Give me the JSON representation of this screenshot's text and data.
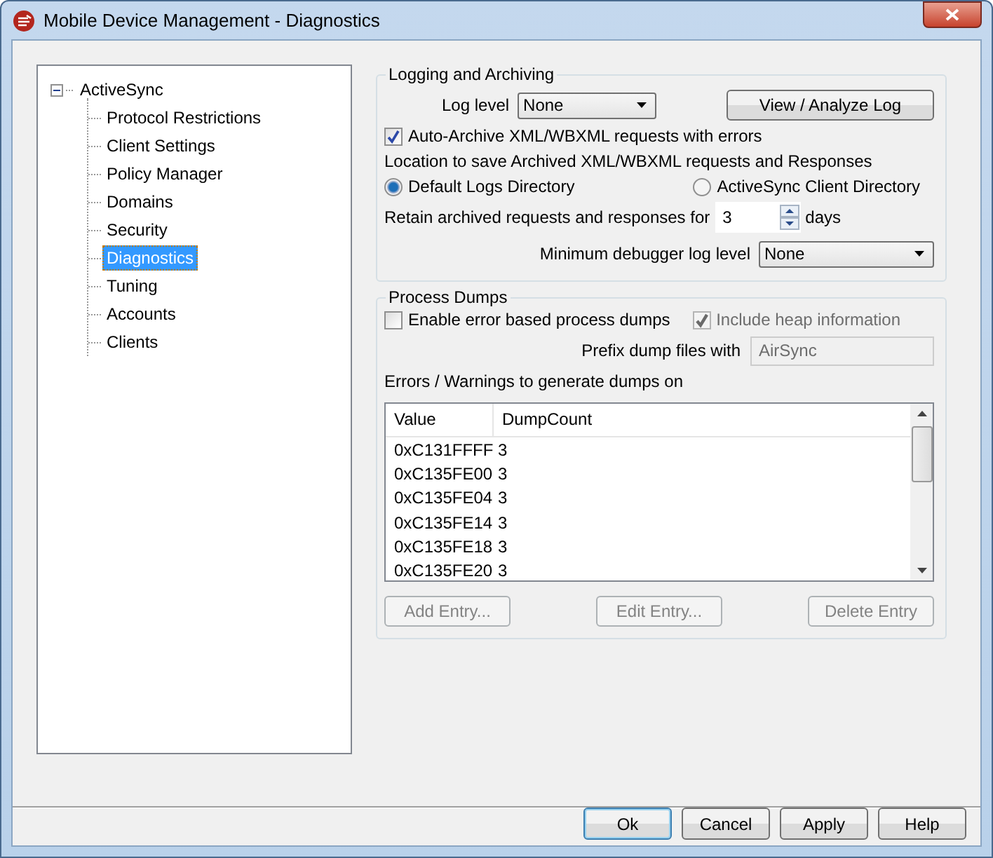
{
  "window": {
    "title": "Mobile Device Management - Diagnostics"
  },
  "tree": [
    {
      "label": "ActiveSync",
      "expanded": true,
      "selected": false,
      "children": [
        {
          "label": "Protocol Restrictions",
          "selected": false
        },
        {
          "label": "Client Settings",
          "selected": false
        },
        {
          "label": "Policy Manager",
          "selected": false
        },
        {
          "label": "Domains",
          "selected": false
        },
        {
          "label": "Security",
          "selected": false
        },
        {
          "label": "Diagnostics",
          "selected": true
        },
        {
          "label": "Tuning",
          "selected": false
        },
        {
          "label": "Accounts",
          "selected": false
        },
        {
          "label": "Clients",
          "selected": false
        }
      ]
    }
  ],
  "logging": {
    "title": "Logging and Archiving",
    "log_level_label": "Log level",
    "log_level": "None",
    "view_button": "View / Analyze Log",
    "auto_archive": {
      "label": "Auto-Archive XML/WBXML requests with errors",
      "checked": true
    },
    "location_label": "Location to save Archived XML/WBXML requests and Responses",
    "locations": [
      {
        "label": "Default Logs Directory",
        "selected": true
      },
      {
        "label": "ActiveSync Client Directory",
        "selected": false
      }
    ],
    "retain_label": "Retain archived requests and responses for",
    "retain_value": "3",
    "retain_unit": "days",
    "debugger_label": "Minimum debugger log level",
    "debugger_level": "None"
  },
  "dumps": {
    "title": "Process Dumps",
    "enable": {
      "label": "Enable error based process dumps",
      "checked": false,
      "disabled": false
    },
    "heap": {
      "label": "Include heap information",
      "checked": true,
      "disabled": true
    },
    "prefix_label": "Prefix dump files with",
    "prefix_value": "AirSync",
    "prefix_disabled": true,
    "list_label": "Errors / Warnings to generate dumps on",
    "columns": [
      "Value",
      "DumpCount"
    ],
    "rows": [
      [
        "0xC131FFFF",
        "3"
      ],
      [
        "0xC135FE00",
        "3"
      ],
      [
        "0xC135FE04",
        "3"
      ],
      [
        "0xC135FE14",
        "3"
      ],
      [
        "0xC135FE18",
        "3"
      ],
      [
        "0xC135FE20",
        "3"
      ]
    ],
    "buttons": [
      {
        "label": "Add Entry...",
        "disabled": true
      },
      {
        "label": "Edit Entry...",
        "disabled": true
      },
      {
        "label": "Delete Entry",
        "disabled": true
      }
    ]
  },
  "buttons": [
    {
      "label": "Ok",
      "default": true
    },
    {
      "label": "Cancel",
      "default": false
    },
    {
      "label": "Apply",
      "default": false
    },
    {
      "label": "Help",
      "default": false
    }
  ]
}
